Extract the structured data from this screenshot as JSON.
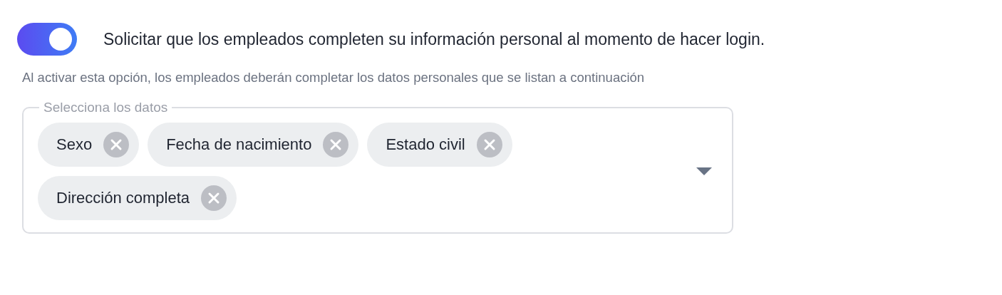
{
  "toggle": {
    "on": true,
    "label": "Solicitar que los empleados completen su información personal al momento de hacer login."
  },
  "helper_text": "Al activar esta opción, los empleados deberán completar los datos personales que se listan a continuación",
  "select": {
    "legend": "Selecciona los datos",
    "chips": [
      {
        "label": "Sexo"
      },
      {
        "label": "Fecha de nacimiento"
      },
      {
        "label": "Estado civil"
      },
      {
        "label": "Dirección completa"
      }
    ]
  }
}
